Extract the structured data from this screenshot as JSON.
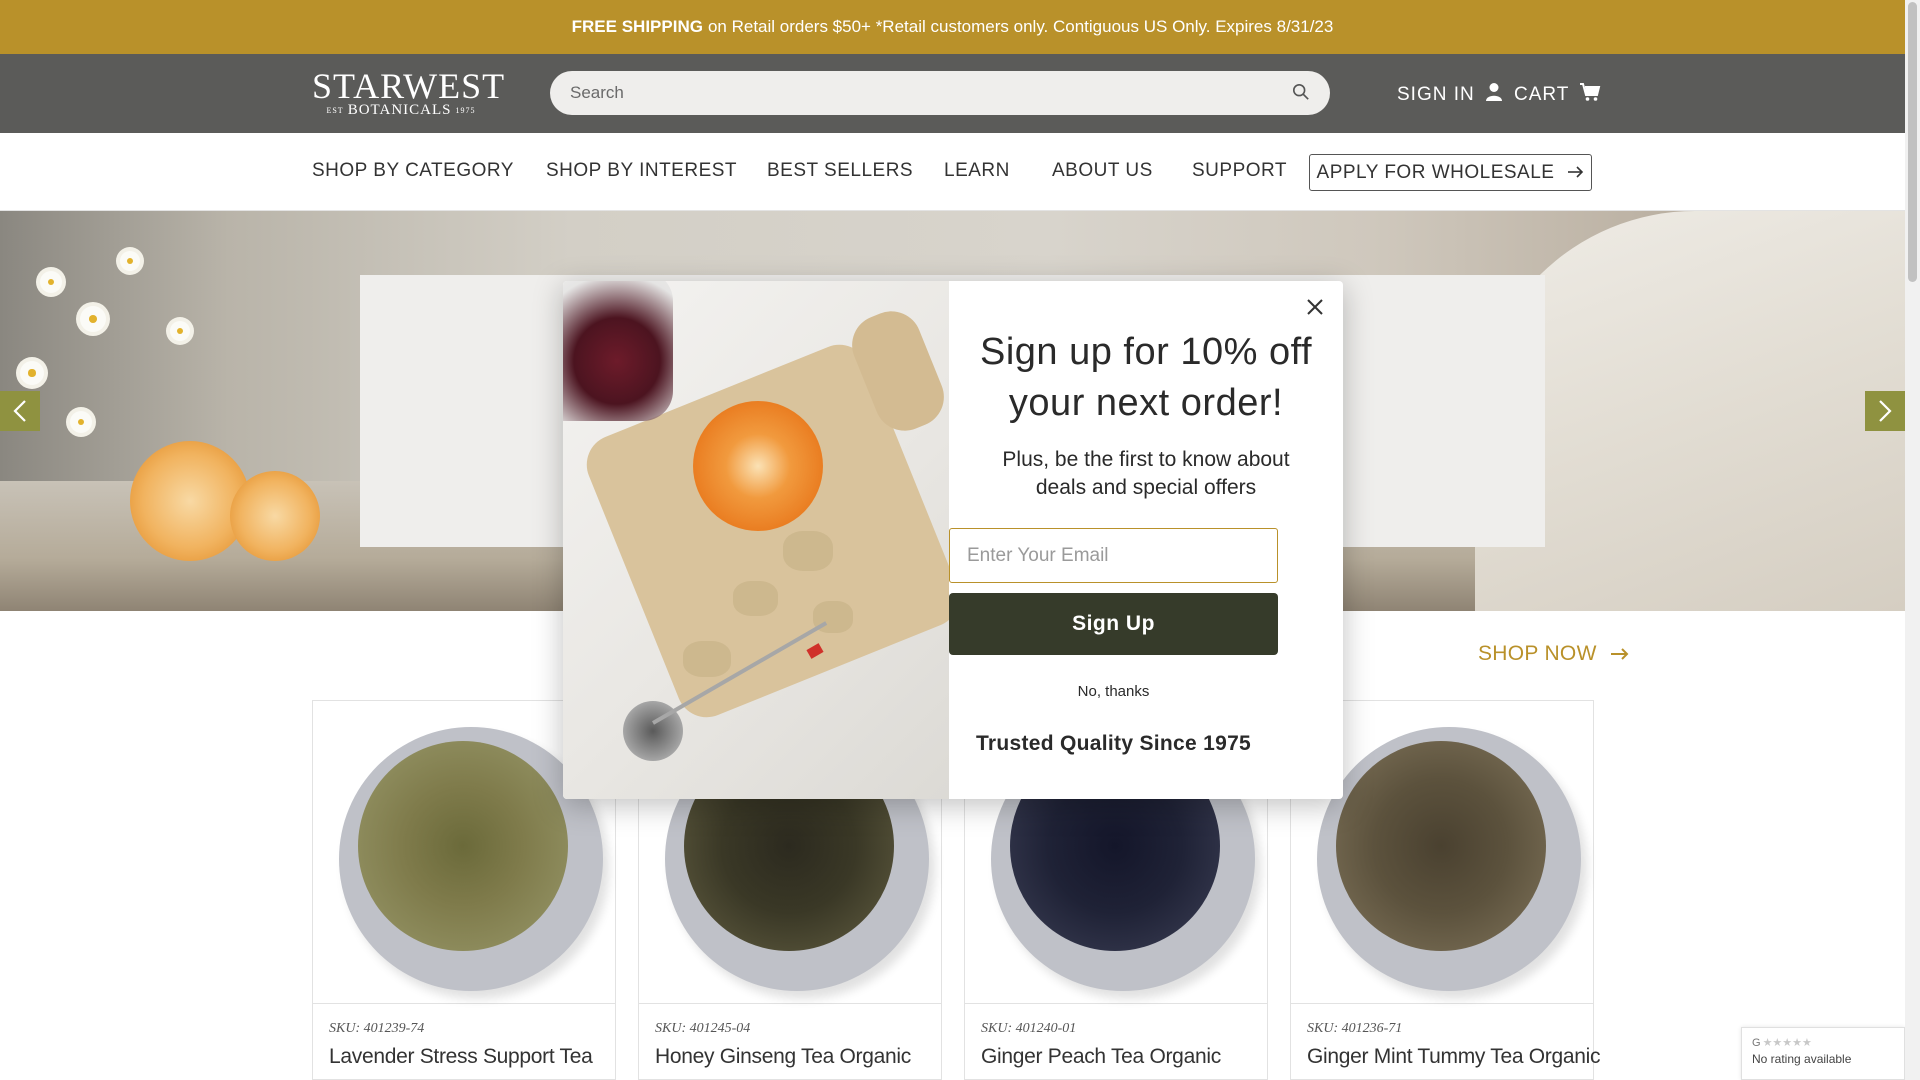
{
  "promo": {
    "bold": "FREE SHIPPING",
    "text": "on Retail orders $50+ *Retail customers only. Contiguous US Only. Expires 8/31/23"
  },
  "header": {
    "logo_word": "STARWEST",
    "logo_est": "EST",
    "logo_sub": "BOTANICALS",
    "logo_year": "1975",
    "search_placeholder": "Search",
    "sign_in": "SIGN IN",
    "cart": "CART"
  },
  "nav": {
    "items": [
      {
        "label": "SHOP BY CATEGORY"
      },
      {
        "label": "SHOP BY INTEREST"
      },
      {
        "label": "BEST SELLERS"
      },
      {
        "label": "LEARN"
      },
      {
        "label": "ABOUT US"
      },
      {
        "label": "SUPPORT"
      }
    ],
    "wholesale": "APPLY FOR WHOLESALE"
  },
  "section": {
    "shop_now": "SHOP NOW"
  },
  "products": [
    {
      "sku": "SKU: 401239-74",
      "name": "Lavender Stress Support Tea"
    },
    {
      "sku": "SKU: 401245-04",
      "name": "Honey Ginseng Tea Organic"
    },
    {
      "sku": "SKU: 401240-01",
      "name": "Ginger Peach Tea Organic"
    },
    {
      "sku": "SKU: 401236-71",
      "name": "Ginger Mint Tummy Tea Organic"
    }
  ],
  "modal": {
    "heading_line1": "Sign up for 10% off",
    "heading_line2": "your next order!",
    "sub_line1": "Plus, be the first to know about",
    "sub_line2": "deals and special offers",
    "email_placeholder": "Enter Your Email",
    "signup": "Sign Up",
    "no_thanks": "No, thanks",
    "trusted": "Trusted Quality Since 1975"
  },
  "rating": {
    "brand": "G",
    "stars": "★★★★★",
    "text": "No rating available"
  },
  "colors": {
    "promo": "#b9912a",
    "header": "#5b5b59",
    "accent": "#b9912a",
    "signup_button": "#363b2a",
    "arrow": "#8f9240"
  }
}
